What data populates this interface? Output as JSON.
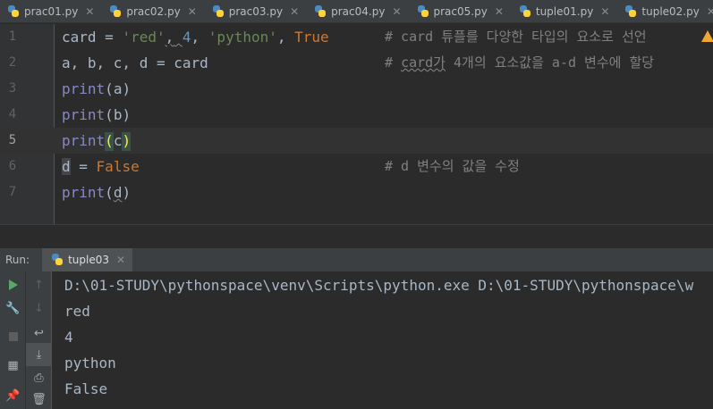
{
  "tabs": [
    {
      "label": "prac01.py"
    },
    {
      "label": "prac02.py"
    },
    {
      "label": "prac03.py"
    },
    {
      "label": "prac04.py"
    },
    {
      "label": "prac05.py"
    },
    {
      "label": "tuple01.py"
    },
    {
      "label": "tuple02.py"
    },
    {
      "label": "tuple03"
    }
  ],
  "editor": {
    "line_numbers": [
      "1",
      "2",
      "3",
      "4",
      "5",
      "6",
      "7"
    ],
    "line1": {
      "var": "card",
      "op": " = ",
      "s1": "'red'",
      "c1": ",",
      "sp": " ",
      "n": "4",
      "c2": ", ",
      "s2": "'python'",
      "c3": ", ",
      "t": "True",
      "comment": "# card 튜플를 다양한 타입의 요소로 선언"
    },
    "line2": {
      "code": "a, b, c, d = card",
      "comment_pre": "# ",
      "comment_word": "card가",
      "comment_rest": " 4개의 요소값을 a-d 변수에 할당"
    },
    "line3": {
      "fn": "print",
      "open": "(",
      "arg": "a",
      "close": ")"
    },
    "line4": {
      "fn": "print",
      "open": "(",
      "arg": "b",
      "close": ")"
    },
    "line5": {
      "fn": "print",
      "open": "(",
      "arg": "c",
      "close": ")"
    },
    "line6": {
      "var": "d",
      "op": " = ",
      "val": "False",
      "comment": "# d 변수의 값을 수정"
    },
    "line7": {
      "fn": "print",
      "open": "(",
      "arg": "d",
      "close": ")"
    }
  },
  "run": {
    "label": "Run:",
    "tab_label": "tuple03",
    "output": [
      "D:\\01-STUDY\\pythonspace\\venv\\Scripts\\python.exe D:\\01-STUDY\\pythonspace\\w",
      "red",
      "4",
      "python",
      "False"
    ]
  },
  "icons": [
    "python-file-icon",
    "close-icon",
    "warning-icon",
    "run-icon",
    "wrench-icon",
    "stop-icon",
    "layout-icon",
    "pin-icon",
    "up-arrow-icon",
    "down-arrow-icon",
    "soft-wrap-icon",
    "scroll-to-end-icon",
    "print-icon",
    "trash-icon"
  ],
  "colors": {
    "accent": "#4a88c7",
    "keyword": "#cc7832",
    "string": "#6a8759",
    "number": "#6897bb",
    "builtin": "#8888c6",
    "comment": "#808080",
    "run_green": "#59a869"
  }
}
